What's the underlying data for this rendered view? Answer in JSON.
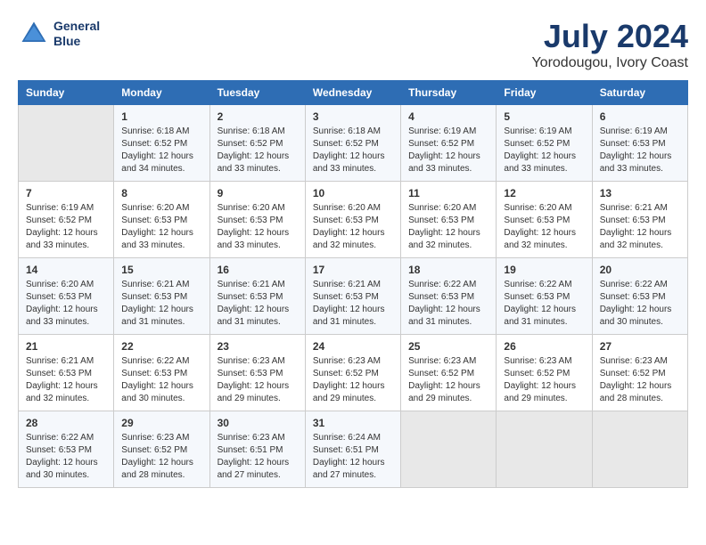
{
  "logo": {
    "line1": "General",
    "line2": "Blue"
  },
  "header": {
    "month_year": "July 2024",
    "location": "Yorodougou, Ivory Coast"
  },
  "days_of_week": [
    "Sunday",
    "Monday",
    "Tuesday",
    "Wednesday",
    "Thursday",
    "Friday",
    "Saturday"
  ],
  "weeks": [
    [
      {
        "day": "",
        "info": ""
      },
      {
        "day": "1",
        "info": "Sunrise: 6:18 AM\nSunset: 6:52 PM\nDaylight: 12 hours\nand 34 minutes."
      },
      {
        "day": "2",
        "info": "Sunrise: 6:18 AM\nSunset: 6:52 PM\nDaylight: 12 hours\nand 33 minutes."
      },
      {
        "day": "3",
        "info": "Sunrise: 6:18 AM\nSunset: 6:52 PM\nDaylight: 12 hours\nand 33 minutes."
      },
      {
        "day": "4",
        "info": "Sunrise: 6:19 AM\nSunset: 6:52 PM\nDaylight: 12 hours\nand 33 minutes."
      },
      {
        "day": "5",
        "info": "Sunrise: 6:19 AM\nSunset: 6:52 PM\nDaylight: 12 hours\nand 33 minutes."
      },
      {
        "day": "6",
        "info": "Sunrise: 6:19 AM\nSunset: 6:53 PM\nDaylight: 12 hours\nand 33 minutes."
      }
    ],
    [
      {
        "day": "7",
        "info": ""
      },
      {
        "day": "8",
        "info": "Sunrise: 6:20 AM\nSunset: 6:53 PM\nDaylight: 12 hours\nand 33 minutes."
      },
      {
        "day": "9",
        "info": "Sunrise: 6:20 AM\nSunset: 6:53 PM\nDaylight: 12 hours\nand 33 minutes."
      },
      {
        "day": "10",
        "info": "Sunrise: 6:20 AM\nSunset: 6:53 PM\nDaylight: 12 hours\nand 32 minutes."
      },
      {
        "day": "11",
        "info": "Sunrise: 6:20 AM\nSunset: 6:53 PM\nDaylight: 12 hours\nand 32 minutes."
      },
      {
        "day": "12",
        "info": "Sunrise: 6:20 AM\nSunset: 6:53 PM\nDaylight: 12 hours\nand 32 minutes."
      },
      {
        "day": "13",
        "info": "Sunrise: 6:21 AM\nSunset: 6:53 PM\nDaylight: 12 hours\nand 32 minutes."
      }
    ],
    [
      {
        "day": "14",
        "info": ""
      },
      {
        "day": "15",
        "info": "Sunrise: 6:21 AM\nSunset: 6:53 PM\nDaylight: 12 hours\nand 31 minutes."
      },
      {
        "day": "16",
        "info": "Sunrise: 6:21 AM\nSunset: 6:53 PM\nDaylight: 12 hours\nand 31 minutes."
      },
      {
        "day": "17",
        "info": "Sunrise: 6:21 AM\nSunset: 6:53 PM\nDaylight: 12 hours\nand 31 minutes."
      },
      {
        "day": "18",
        "info": "Sunrise: 6:22 AM\nSunset: 6:53 PM\nDaylight: 12 hours\nand 31 minutes."
      },
      {
        "day": "19",
        "info": "Sunrise: 6:22 AM\nSunset: 6:53 PM\nDaylight: 12 hours\nand 31 minutes."
      },
      {
        "day": "20",
        "info": "Sunrise: 6:22 AM\nSunset: 6:53 PM\nDaylight: 12 hours\nand 30 minutes."
      }
    ],
    [
      {
        "day": "21",
        "info": ""
      },
      {
        "day": "22",
        "info": "Sunrise: 6:22 AM\nSunset: 6:53 PM\nDaylight: 12 hours\nand 30 minutes."
      },
      {
        "day": "23",
        "info": "Sunrise: 6:23 AM\nSunset: 6:53 PM\nDaylight: 12 hours\nand 29 minutes."
      },
      {
        "day": "24",
        "info": "Sunrise: 6:23 AM\nSunset: 6:52 PM\nDaylight: 12 hours\nand 29 minutes."
      },
      {
        "day": "25",
        "info": "Sunrise: 6:23 AM\nSunset: 6:52 PM\nDaylight: 12 hours\nand 29 minutes."
      },
      {
        "day": "26",
        "info": "Sunrise: 6:23 AM\nSunset: 6:52 PM\nDaylight: 12 hours\nand 29 minutes."
      },
      {
        "day": "27",
        "info": "Sunrise: 6:23 AM\nSunset: 6:52 PM\nDaylight: 12 hours\nand 28 minutes."
      }
    ],
    [
      {
        "day": "28",
        "info": "Sunrise: 6:23 AM\nSunset: 6:52 PM\nDaylight: 12 hours\nand 28 minutes."
      },
      {
        "day": "29",
        "info": "Sunrise: 6:23 AM\nSunset: 6:52 PM\nDaylight: 12 hours\nand 28 minutes."
      },
      {
        "day": "30",
        "info": "Sunrise: 6:23 AM\nSunset: 6:51 PM\nDaylight: 12 hours\nand 27 minutes."
      },
      {
        "day": "31",
        "info": "Sunrise: 6:24 AM\nSunset: 6:51 PM\nDaylight: 12 hours\nand 27 minutes."
      },
      {
        "day": "",
        "info": ""
      },
      {
        "day": "",
        "info": ""
      },
      {
        "day": "",
        "info": ""
      }
    ]
  ],
  "week7_sunday": {
    "info": "Sunrise: 6:19 AM\nSunset: 6:52 PM\nDaylight: 12 hours\nand 33 minutes."
  },
  "week14_sunday": {
    "info": "Sunrise: 6:20 AM\nSunset: 6:53 PM\nDaylight: 12 hours\nand 33 minutes."
  },
  "week21_sunday": {
    "info": "Sunrise: 6:21 AM\nSunset: 6:53 PM\nDaylight: 12 hours\nand 32 minutes."
  },
  "week28_sunday": {
    "info": "Sunrise: 6:22 AM\nSunset: 6:53 PM\nDaylight: 12 hours\nand 30 minutes."
  }
}
